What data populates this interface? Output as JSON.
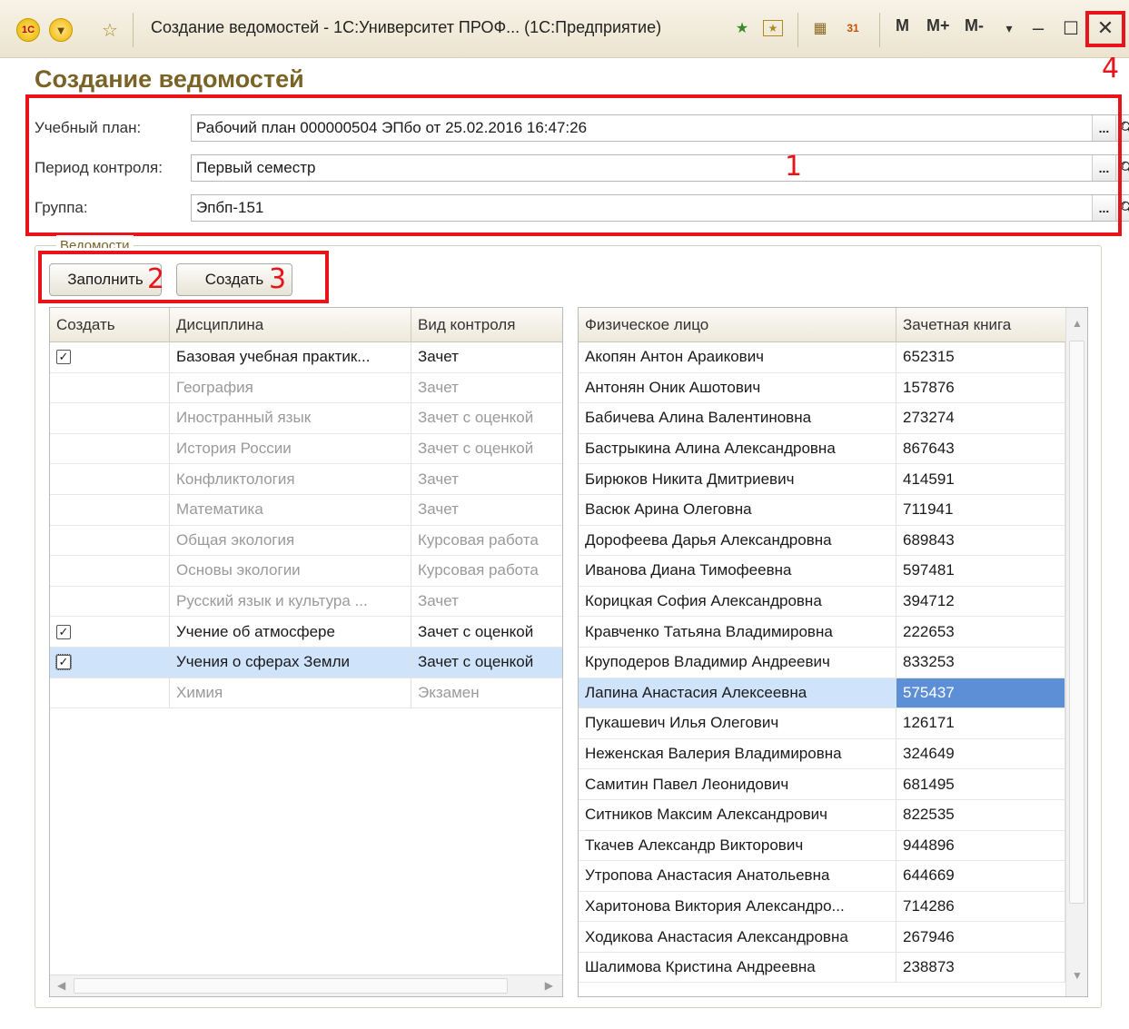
{
  "window": {
    "title": "Создание ведомостей - 1С:Университет ПРОФ... (1С:Предприятие)",
    "logo_text": "1С",
    "m_labels": [
      "M",
      "M+",
      "M-"
    ],
    "close_glyph": "✕"
  },
  "form": {
    "title": "Создание ведомостей",
    "fields": [
      {
        "label": "Учебный план:",
        "value": "Рабочий план 000000504 ЭПбо от 25.02.2016 16:47:26"
      },
      {
        "label": "Период контроля:",
        "value": "Первый семестр"
      },
      {
        "label": "Группа:",
        "value": "Эпбп-151"
      }
    ],
    "field_button_dots": "...",
    "group_label": "Ведомости",
    "buttons": {
      "fill": "Заполнить",
      "create": "Создать"
    }
  },
  "annotations": [
    "1",
    "2",
    "3",
    "4"
  ],
  "left_table": {
    "headers": [
      "Создать",
      "Дисциплина",
      "Вид контроля"
    ],
    "rows": [
      {
        "checked": true,
        "discipline": "Базовая учебная практик...",
        "control": "Зачет",
        "gray": false
      },
      {
        "checked": false,
        "discipline": "География",
        "control": "Зачет",
        "gray": true
      },
      {
        "checked": false,
        "discipline": "Иностранный язык",
        "control": "Зачет с оценкой",
        "gray": true
      },
      {
        "checked": false,
        "discipline": "История России",
        "control": "Зачет с оценкой",
        "gray": true
      },
      {
        "checked": false,
        "discipline": "Конфликтология",
        "control": "Зачет",
        "gray": true
      },
      {
        "checked": false,
        "discipline": "Математика",
        "control": "Зачет",
        "gray": true
      },
      {
        "checked": false,
        "discipline": "Общая экология",
        "control": "Курсовая работа",
        "gray": true
      },
      {
        "checked": false,
        "discipline": "Основы экологии",
        "control": "Курсовая работа",
        "gray": true
      },
      {
        "checked": false,
        "discipline": "Русский язык и культура ...",
        "control": "Зачет",
        "gray": true
      },
      {
        "checked": true,
        "discipline": "Учение об атмосфере",
        "control": "Зачет с оценкой",
        "gray": false
      },
      {
        "checked": true,
        "discipline": "Учения о сферах Земли",
        "control": "Зачет с оценкой",
        "gray": false,
        "selected": true
      },
      {
        "checked": false,
        "discipline": "Химия",
        "control": "Экзамен",
        "gray": true
      }
    ]
  },
  "right_table": {
    "headers": [
      "Физическое лицо",
      "Зачетная книга"
    ],
    "rows": [
      {
        "person": "Акопян Антон Араикович",
        "book": "652315"
      },
      {
        "person": "Антонян Оник Ашотович",
        "book": "157876"
      },
      {
        "person": "Бабичева Алина Валентиновна",
        "book": "273274"
      },
      {
        "person": "Бастрыкина Алина Александровна",
        "book": "867643"
      },
      {
        "person": "Бирюков Никита Дмитриевич",
        "book": "414591"
      },
      {
        "person": "Васюк Арина Олеговна",
        "book": "711941"
      },
      {
        "person": "Дорофеева Дарья Александровна",
        "book": "689843"
      },
      {
        "person": "Иванова Диана Тимофеевна",
        "book": "597481"
      },
      {
        "person": "Корицкая София Александровна",
        "book": "394712"
      },
      {
        "person": "Кравченко Татьяна Владимировна",
        "book": "222653"
      },
      {
        "person": "Круподеров Владимир Андреевич",
        "book": "833253"
      },
      {
        "person": "Лапина Анастасия Алексеевна",
        "book": "575437",
        "selected": true
      },
      {
        "person": "Пукашевич Илья Олегович",
        "book": "126171"
      },
      {
        "person": "Неженская Валерия Владимировна",
        "book": "324649"
      },
      {
        "person": "Самитин Павел Леонидович",
        "book": "681495"
      },
      {
        "person": "Ситников Максим Александрович",
        "book": "822535"
      },
      {
        "person": "Ткачев Александр Викторович",
        "book": "944896"
      },
      {
        "person": "Утропова Анастасия Анатольевна",
        "book": "644669"
      },
      {
        "person": "Харитонова Виктория Александро...",
        "book": "714286"
      },
      {
        "person": "Ходикова Анастасия Александровна",
        "book": "267946"
      },
      {
        "person": "Шалимова Кристина Андреевна",
        "book": "238873"
      }
    ]
  }
}
